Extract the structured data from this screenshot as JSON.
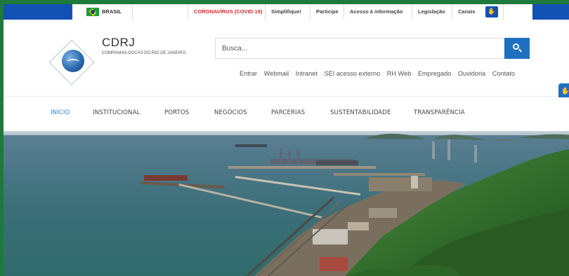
{
  "govbar": {
    "country": "BRASIL",
    "items": [
      "CORONAVÍRUS (COVID-19)",
      "Simplifique!",
      "Participe",
      "Acesso à informação",
      "Legislação",
      "Canais"
    ]
  },
  "brand": {
    "title": "CDRJ",
    "subtitle": "COMPANHIA DOCAS DO RIO DE JANEIRO"
  },
  "search": {
    "placeholder": "Busca..."
  },
  "utility_links": [
    "Entrar",
    "Webmail",
    "Intranet",
    "SEI acesso externo",
    "RH Web",
    "Empregado",
    "Ouvidoria",
    "Contato"
  ],
  "nav": {
    "items": [
      "INÍCIO",
      "INSTITUCIONAL",
      "PORTOS",
      "NEGÓCIOS",
      "PARCERIAS",
      "SUSTENTABILIDADE",
      "TRANSPARÊNCIA"
    ]
  },
  "colors": {
    "gov_blue": "#1351b4",
    "accent_blue": "#1f6fc1",
    "covid_red": "#d22d2d",
    "nav_active": "#2d7fd4"
  },
  "icons": {
    "search": "search-icon",
    "libras": "hand-icon",
    "flag": "brazil-flag-icon"
  }
}
